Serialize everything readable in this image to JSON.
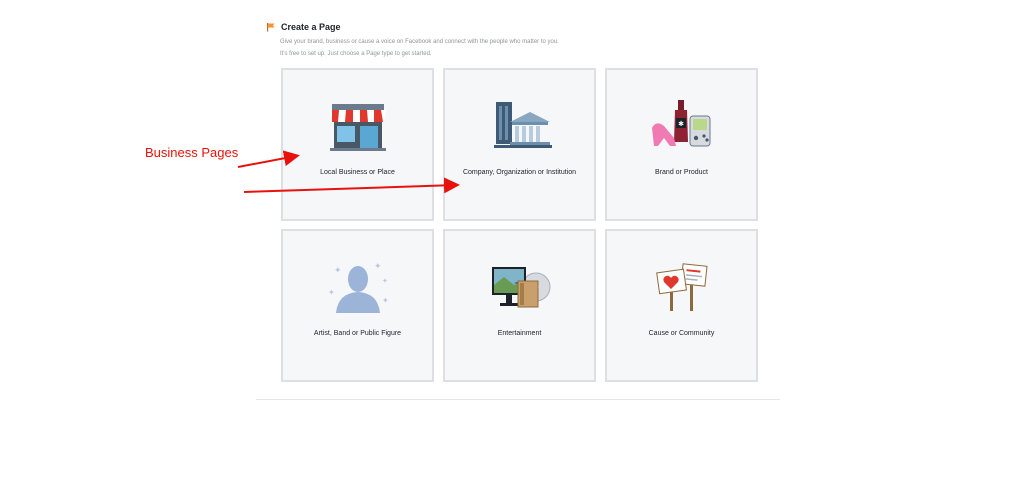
{
  "header": {
    "title": "Create a Page",
    "subtitle_line1": "Give your brand, business or cause a voice on Facebook and connect with the people who matter to you.",
    "subtitle_line2": "It's free to set up. Just choose a Page type to get started."
  },
  "tiles": [
    {
      "label": "Local Business or Place",
      "icon": "storefront-icon"
    },
    {
      "label": "Company, Organization or Institution",
      "icon": "office-buildings-icon"
    },
    {
      "label": "Brand or Product",
      "icon": "products-icon"
    },
    {
      "label": "Artist, Band or Public Figure",
      "icon": "silhouette-icon"
    },
    {
      "label": "Entertainment",
      "icon": "media-icon"
    },
    {
      "label": "Cause or Community",
      "icon": "protest-signs-icon"
    }
  ],
  "annotation": {
    "text": "Business Pages",
    "color": "#e8120c"
  },
  "colors": {
    "tile_bg": "#f6f7f9",
    "tile_border": "#dddfe2",
    "subtitle": "#90949c",
    "accent_orange": "#f7923a"
  }
}
